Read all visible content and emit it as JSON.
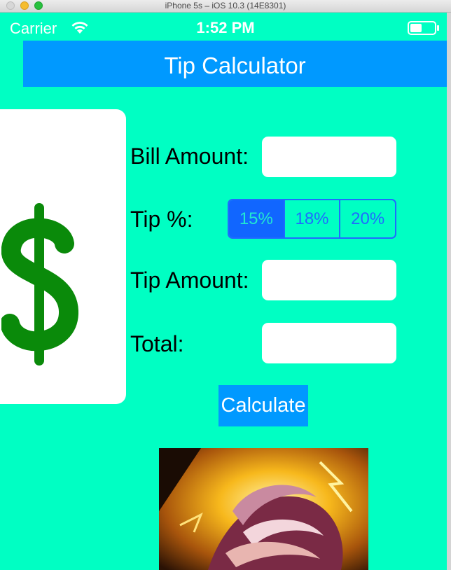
{
  "window": {
    "title": "iPhone 5s – iOS 10.3 (14E8301)"
  },
  "status_bar": {
    "carrier": "Carrier",
    "time": "1:52 PM"
  },
  "nav": {
    "title": "Tip Calculator"
  },
  "form": {
    "bill_label": "Bill Amount:",
    "bill_value": "",
    "tip_label": "Tip %:",
    "tip_options": [
      "15%",
      "18%",
      "20%"
    ],
    "tip_selected": "15%",
    "tip_amount_label": "Tip Amount:",
    "tip_amount_value": "",
    "total_label": "Total:",
    "total_value": ""
  },
  "actions": {
    "calculate_label": "Calculate"
  },
  "colors": {
    "background": "#00ffc3",
    "header": "#0099ff",
    "segment_tint": "#1f6bff",
    "dollar_green": "#0a8a0a"
  },
  "icons": {
    "dollar": "dollar-sign-icon",
    "wifi": "wifi-icon",
    "battery": "battery-icon"
  }
}
